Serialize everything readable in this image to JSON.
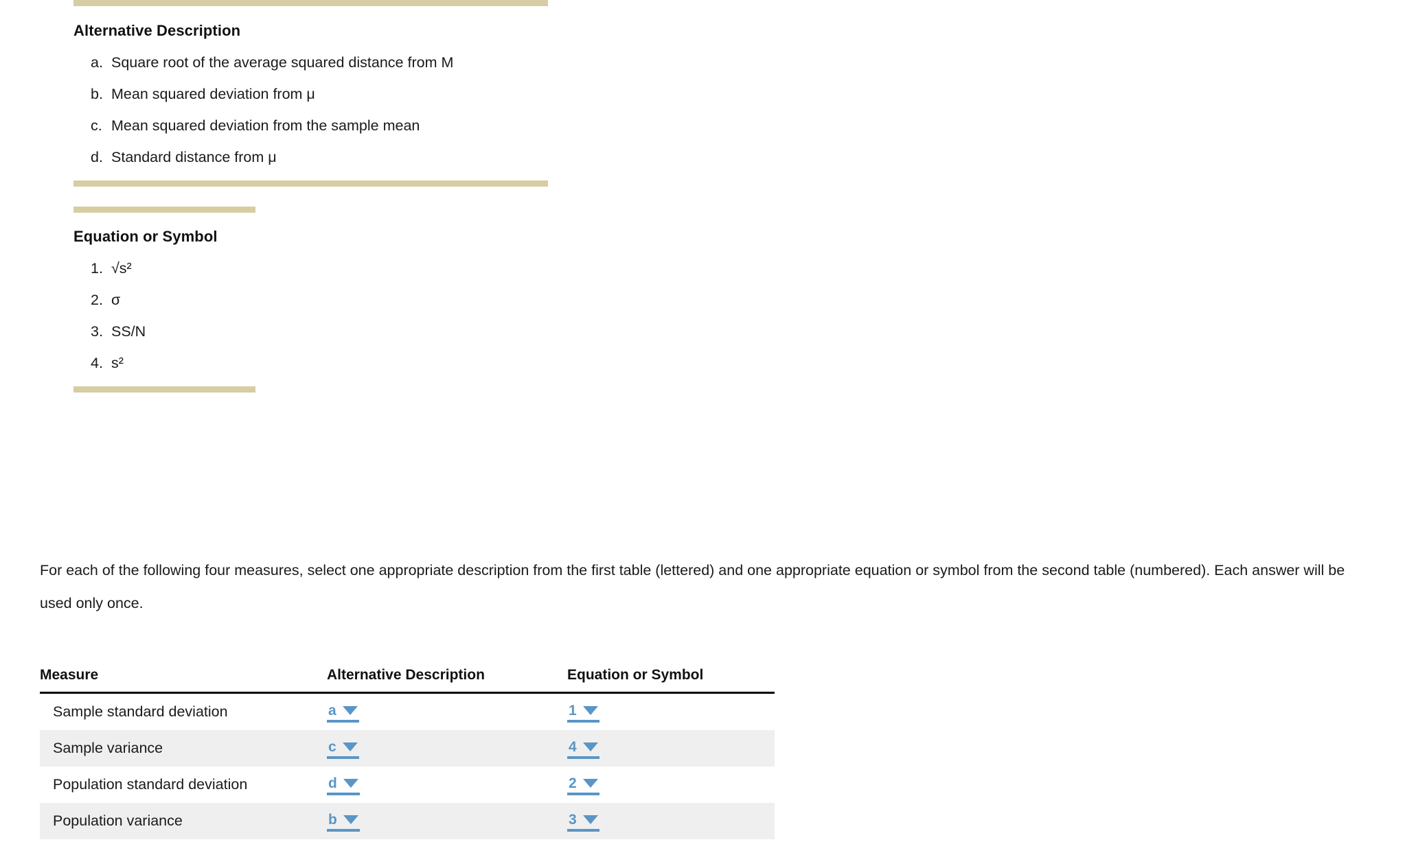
{
  "reference_tables": [
    {
      "id": "alternative-description",
      "title": "Alternative Description",
      "items": [
        {
          "marker": "a.",
          "text": "Square root of the average squared distance from M"
        },
        {
          "marker": "b.",
          "text": "Mean squared deviation from μ"
        },
        {
          "marker": "c.",
          "text": "Mean squared deviation from the sample mean"
        },
        {
          "marker": "d.",
          "text": "Standard distance from μ"
        }
      ]
    },
    {
      "id": "equation-or-symbol",
      "title": "Equation or Symbol",
      "items": [
        {
          "marker": "1.",
          "text": "√s²"
        },
        {
          "marker": "2.",
          "text": "σ"
        },
        {
          "marker": "3.",
          "text": "SS/N"
        },
        {
          "marker": "4.",
          "text": "s²"
        }
      ]
    }
  ],
  "instructions": "For each of the following four measures, select one appropriate description from the first table (lettered) and one appropriate equation or symbol from the second table (numbered). Each answer will be used only once.",
  "answer_table": {
    "headers": [
      "Measure",
      "Alternative Description",
      "Equation or Symbol"
    ],
    "rows": [
      {
        "measure": "Sample standard deviation",
        "description": "a",
        "equation": "1"
      },
      {
        "measure": "Sample variance",
        "description": "c",
        "equation": "4"
      },
      {
        "measure": "Population standard deviation",
        "description": "d",
        "equation": "2"
      },
      {
        "measure": "Population variance",
        "description": "b",
        "equation": "3"
      }
    ]
  },
  "colors": {
    "rule_tan": "#d7cda4",
    "dropdown_blue": "#5b95c5",
    "row_stripe": "#efefef",
    "text": "#1a1a1a"
  }
}
